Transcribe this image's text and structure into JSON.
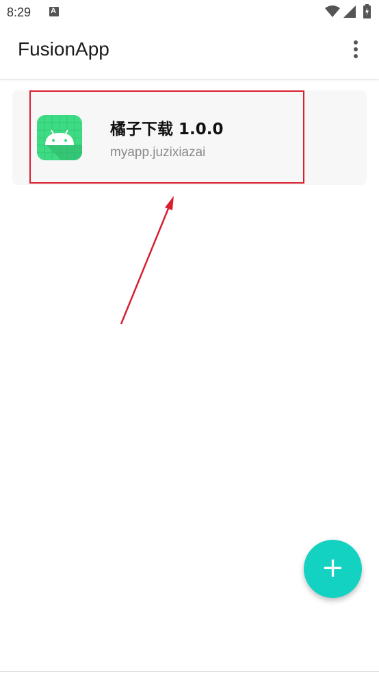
{
  "status_bar": {
    "time": "8:29",
    "notification_icon": "text-a-icon",
    "wifi_icon": "wifi-icon",
    "signal_icon": "cell-signal-icon",
    "battery_icon": "battery-charging-icon"
  },
  "app_bar": {
    "title": "FusionApp",
    "menu_icon": "more-vert-icon"
  },
  "projects": [
    {
      "icon": "android-app-icon",
      "name": "橘子下载 1.0.0",
      "package": "myapp.juzixiazai"
    }
  ],
  "fab": {
    "icon": "add-icon",
    "symbol": "+"
  },
  "colors": {
    "accent": "#14d2c1",
    "annotation_red": "#d71f2f",
    "icon_green": "#3ddc84"
  }
}
